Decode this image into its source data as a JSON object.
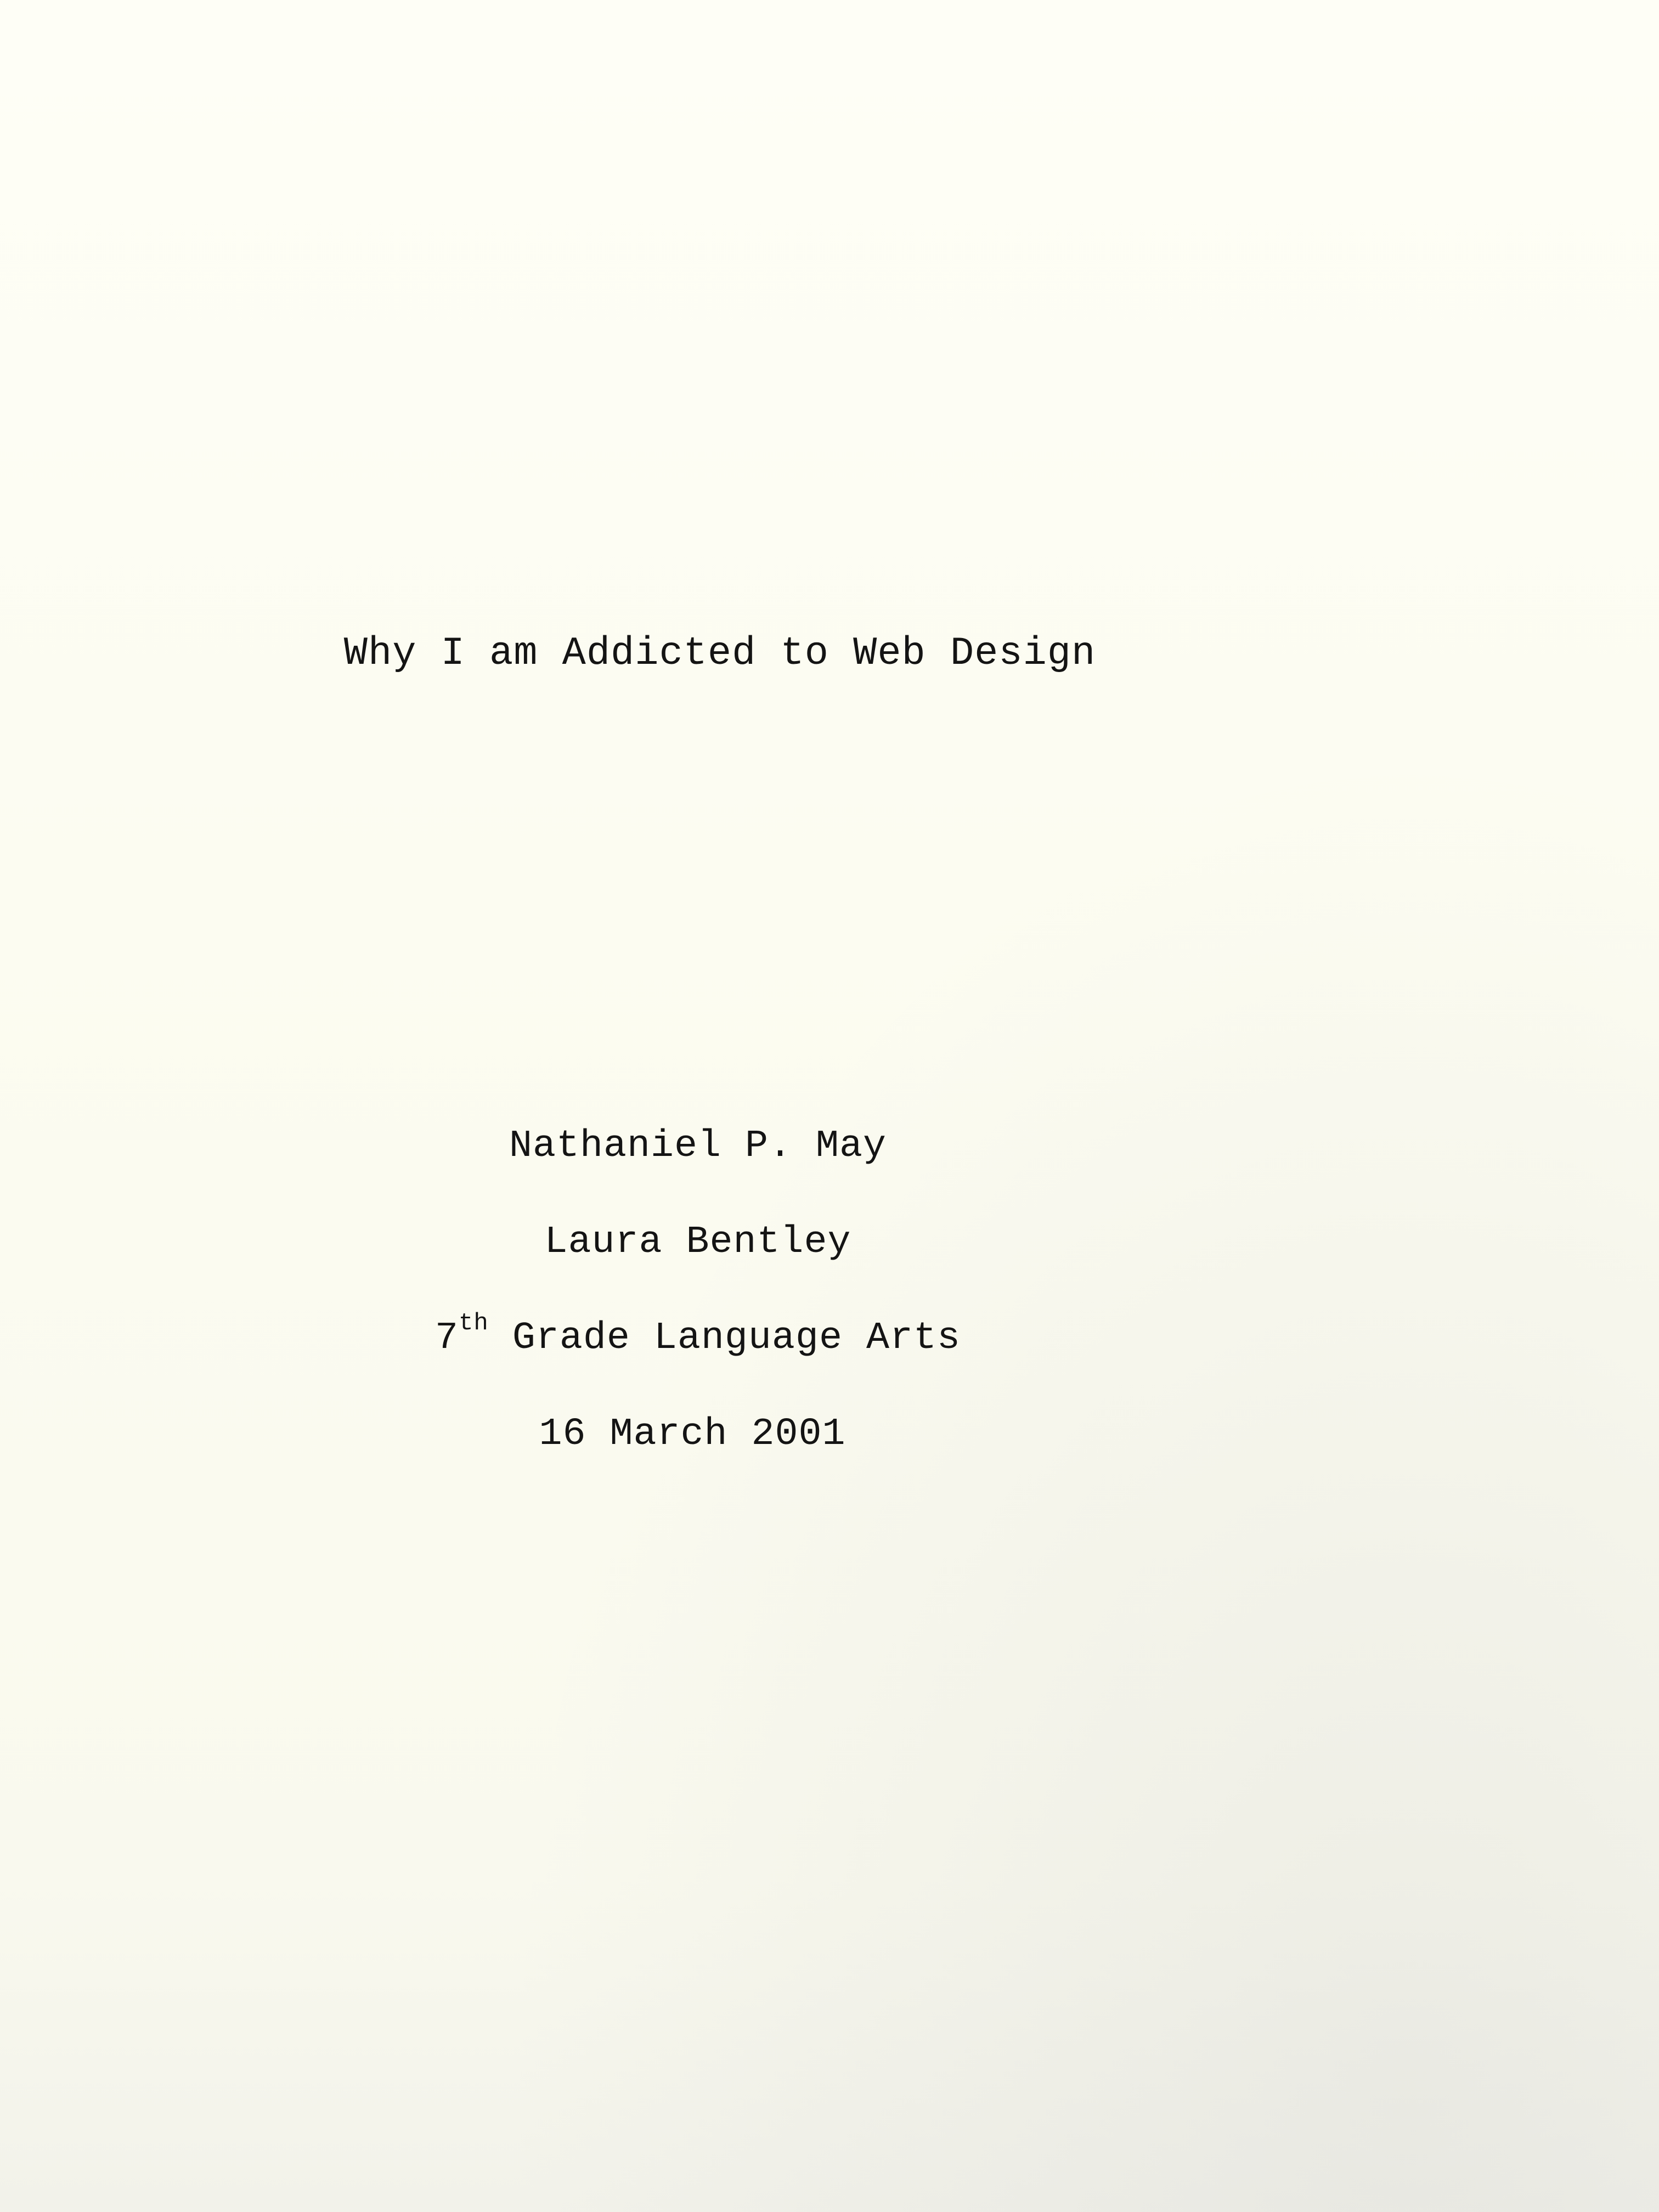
{
  "document": {
    "title": "Why I am Addicted to Web Design",
    "author": "Nathaniel P. May",
    "teacher": "Laura Bentley",
    "course": {
      "grade_number": "7",
      "grade_suffix": "th",
      "rest": " Grade Language Arts"
    },
    "date": "16 March 2001"
  }
}
